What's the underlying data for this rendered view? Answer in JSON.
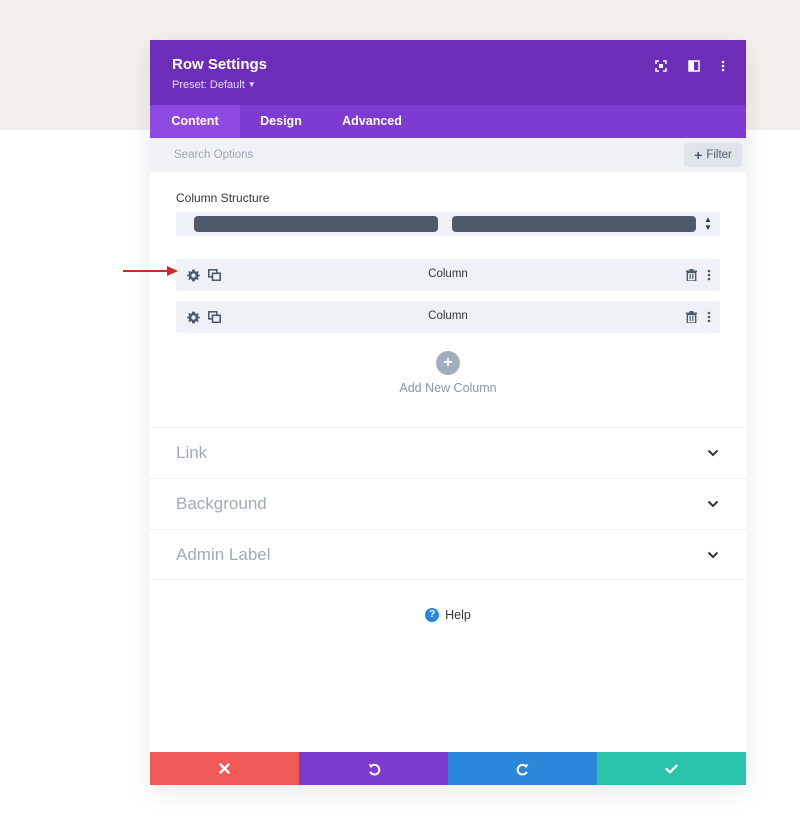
{
  "modal": {
    "title": "Row Settings",
    "preset": "Preset: Default",
    "header_icons": [
      "fullscreen-icon",
      "split-view-icon",
      "more-options-icon"
    ]
  },
  "tabs": [
    {
      "label": "Content",
      "active": true
    },
    {
      "label": "Design",
      "active": false
    },
    {
      "label": "Advanced",
      "active": false
    }
  ],
  "search": {
    "placeholder": "Search Options",
    "value": "",
    "filter_label": "Filter"
  },
  "column_structure": {
    "label": "Column Structure",
    "columns": 2
  },
  "columns": [
    {
      "label": "Column"
    },
    {
      "label": "Column"
    }
  ],
  "add_column": {
    "label": "Add New Column"
  },
  "sections": [
    {
      "label": "Link"
    },
    {
      "label": "Background"
    },
    {
      "label": "Admin Label"
    }
  ],
  "help": {
    "label": "Help"
  },
  "footer": {
    "buttons": [
      {
        "name": "discard",
        "icon": "close-icon",
        "color": "#ef5a58"
      },
      {
        "name": "undo",
        "icon": "undo-icon",
        "color": "#7e3bd0"
      },
      {
        "name": "redo",
        "icon": "redo-icon",
        "color": "#2b87da"
      },
      {
        "name": "save",
        "icon": "check-icon",
        "color": "#29c4a9"
      }
    ]
  },
  "colors": {
    "header": "#6c2eb9",
    "tabs": "#7d3bd1",
    "active_tab": "#8f49e3",
    "annotation_arrow": "#d42626"
  }
}
